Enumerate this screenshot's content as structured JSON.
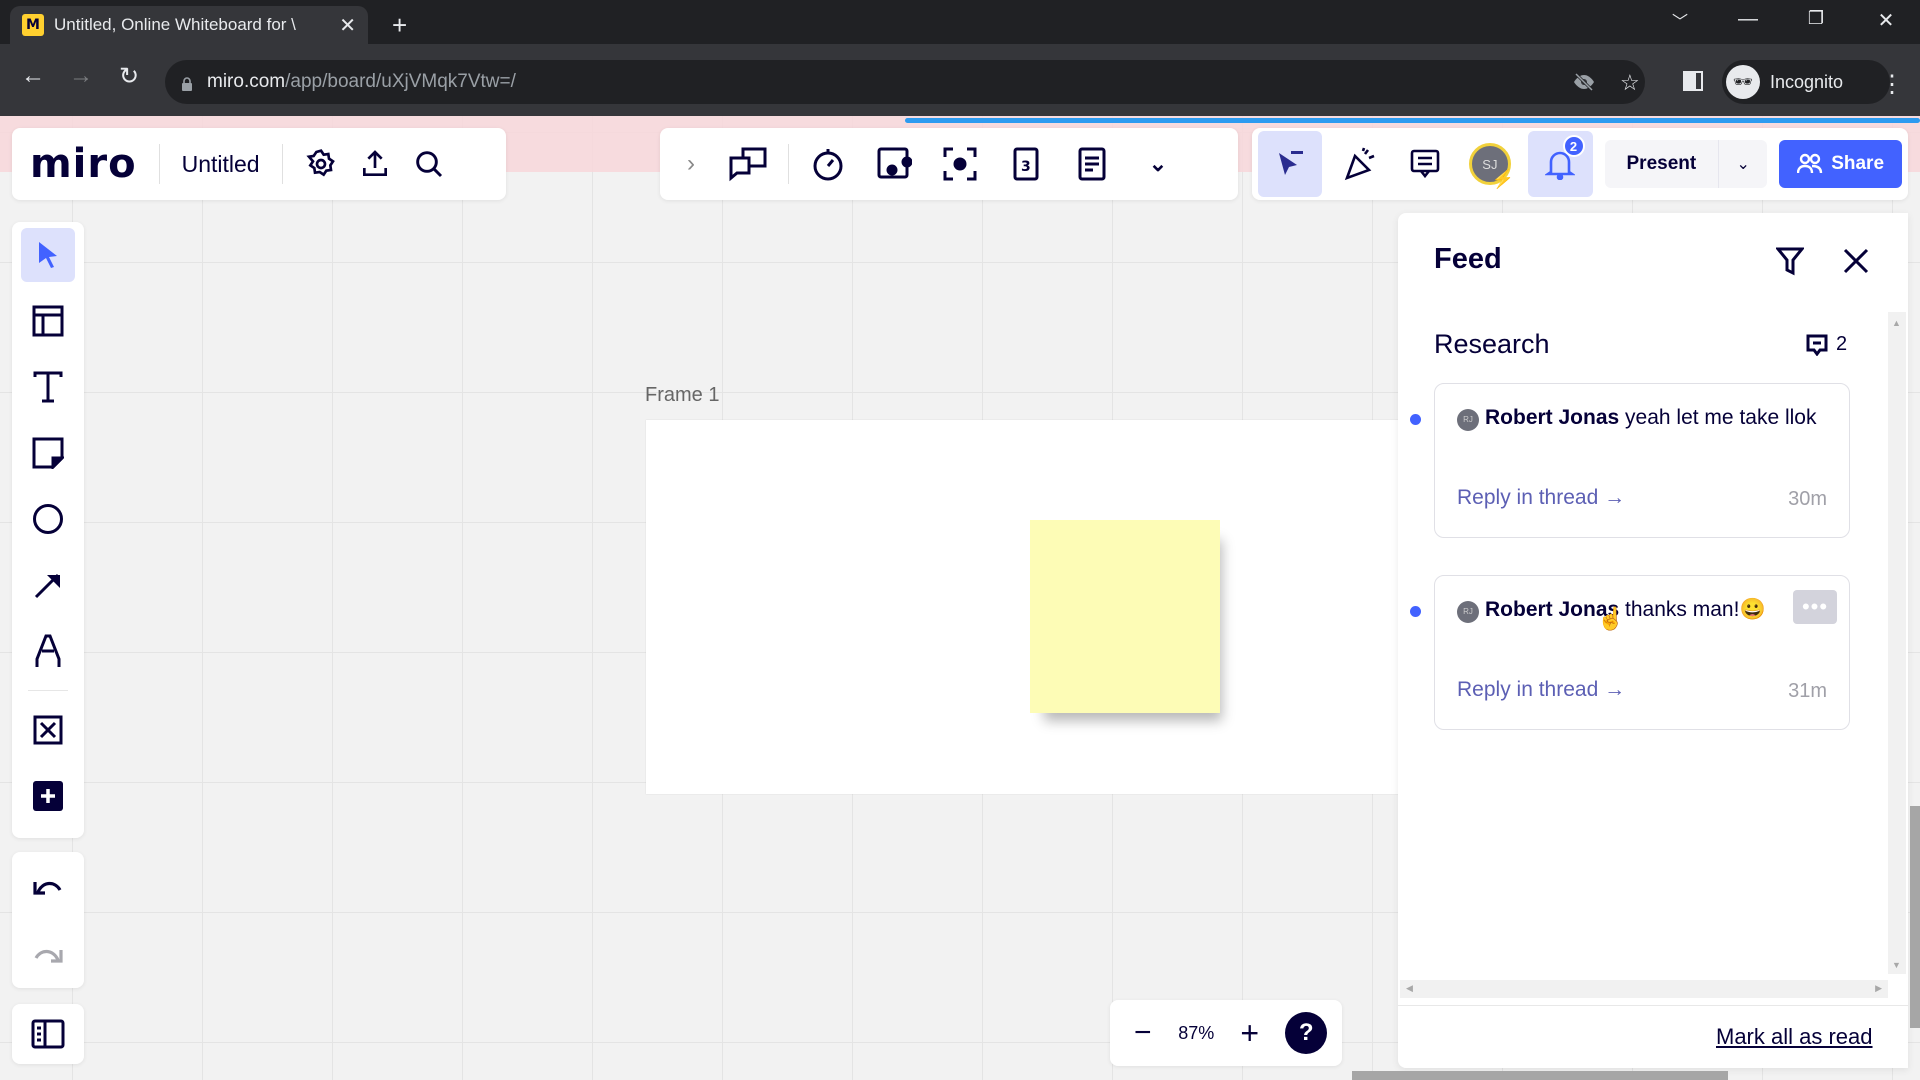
{
  "browser": {
    "tab_title": "Untitled, Online Whiteboard for \\",
    "tab_favicon": "miro-logo",
    "url_host": "miro.com",
    "url_path": "/app/board/uXjVMqk7Vtw=/",
    "profile_label": "Incognito",
    "icons": [
      "back-arrow",
      "forward-arrow",
      "reload",
      "lock",
      "eye-off",
      "star",
      "side-panel",
      "incognito",
      "kebab-menu",
      "tab-search",
      "minimize",
      "restore",
      "close"
    ]
  },
  "board": {
    "logo": "miro",
    "name": "Untitled",
    "zoom": "87%",
    "frame_label": "Frame 1",
    "sticky_color": "#fdfcb6"
  },
  "toolbar": {
    "present_label": "Present",
    "share_label": "Share",
    "avatar_initials": "SJ",
    "notifications_count": "2",
    "accent": "#4262ff"
  },
  "left_tools": [
    "select",
    "templates",
    "text",
    "sticky-note",
    "shape",
    "connector",
    "pen",
    "frame",
    "more-apps",
    "undo",
    "redo",
    "board-panel"
  ],
  "feed": {
    "title": "Feed",
    "section_title": "Research",
    "section_comment_count": "2",
    "items": [
      {
        "initials": "RJ",
        "author": "Robert Jonas",
        "message": "yeah let me take llok",
        "reply_label": "Reply in thread →",
        "time": "30m",
        "unread": true
      },
      {
        "initials": "RJ",
        "author": "Robert Jonas",
        "message": "thanks man!😀",
        "reply_label": "Reply in thread →",
        "time": "31m",
        "unread": true
      }
    ],
    "mark_all_label": "Mark all as read"
  }
}
